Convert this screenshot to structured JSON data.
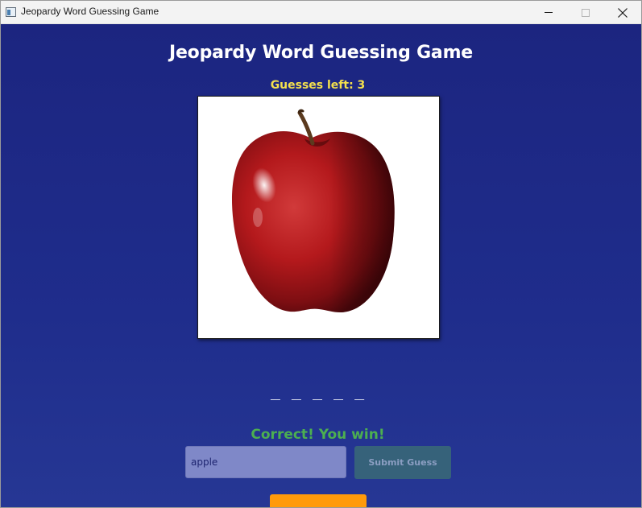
{
  "window": {
    "title": "Jeopardy Word Guessing Game",
    "icon": "app-window-icon",
    "controls": [
      "minimize-icon",
      "maximize-icon",
      "close-icon"
    ]
  },
  "game": {
    "title": "Jeopardy Word Guessing Game",
    "guesses_left": "Guesses left: 3",
    "image_subject": "apple",
    "word_blanks": "_ _ _ _ _",
    "result_message": "Correct! You win!",
    "input_value": "apple",
    "submit_label": "Submit Guess"
  },
  "colors": {
    "background": "#1f2d8c",
    "guesses_text": "#f4e04d",
    "result_text": "#4caf50",
    "input_bg": "#7f88c8",
    "submit_bg": "#36627a",
    "action_button": "#ff9a0a"
  }
}
